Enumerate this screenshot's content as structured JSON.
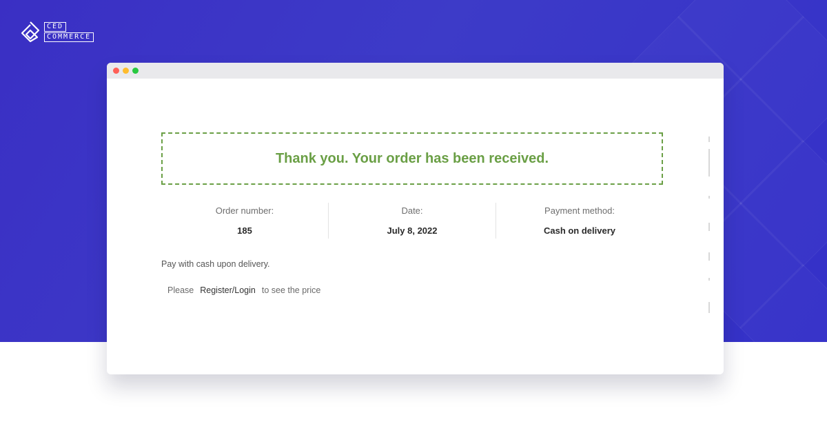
{
  "brand": {
    "line1": "CED",
    "line2": "COMMERCE"
  },
  "colors": {
    "background": "#3a35c6",
    "success": "#6a9f45"
  },
  "order": {
    "notice": "Thank you. Your order has been received.",
    "fields": [
      {
        "label": "Order number:",
        "value": "185"
      },
      {
        "label": "Date:",
        "value": "July 8, 2022"
      },
      {
        "label": "Payment method:",
        "value": "Cash on delivery"
      }
    ],
    "payment_note": "Pay with cash upon delivery.",
    "price_note": {
      "prefix": "Please",
      "link": "Register/Login",
      "suffix": "to see the price"
    }
  }
}
